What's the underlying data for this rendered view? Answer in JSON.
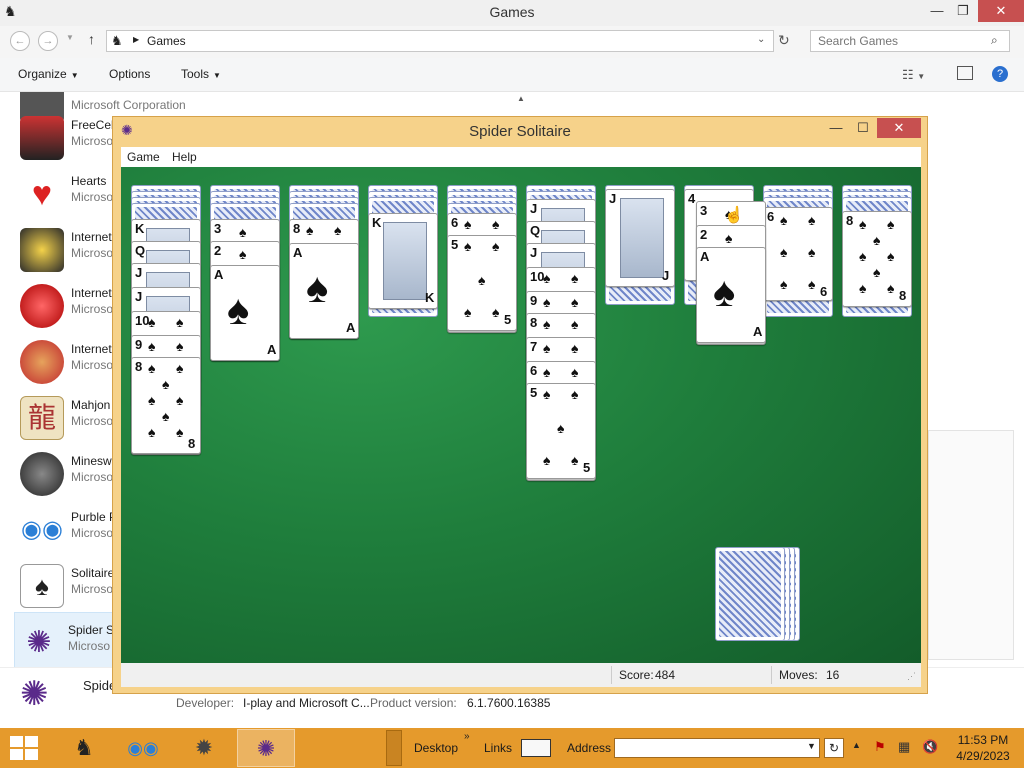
{
  "explorer": {
    "title": "Games",
    "breadcrumb": "Games",
    "search_placeholder": "Search Games",
    "commands": [
      "Organize",
      "Options",
      "Tools"
    ],
    "games": [
      {
        "name": "",
        "publisher": "Microsoft Corporation",
        "icon": "chess-icon"
      },
      {
        "name": "FreeCell",
        "publisher": "Microso",
        "icon": "freecell-icon"
      },
      {
        "name": "Hearts",
        "publisher": "Microso",
        "icon": "hearts-icon"
      },
      {
        "name": "Internet",
        "publisher": "Microso",
        "icon": "internet-backgammon-icon"
      },
      {
        "name": "Internet",
        "publisher": "Microso",
        "icon": "internet-checkers-icon"
      },
      {
        "name": "Internet",
        "publisher": "Microso",
        "icon": "internet-spades-icon"
      },
      {
        "name": "Mahjon",
        "publisher": "Microso",
        "icon": "mahjong-icon"
      },
      {
        "name": "Minesw",
        "publisher": "Microso",
        "icon": "minesweeper-icon"
      },
      {
        "name": "Purble P",
        "publisher": "Microso",
        "icon": "purble-place-icon"
      },
      {
        "name": "Solitaire",
        "publisher": "Microso",
        "icon": "solitaire-icon"
      },
      {
        "name": "Spider S",
        "publisher": "Microso",
        "icon": "spider-solitaire-icon"
      }
    ],
    "details": {
      "name": "Spide",
      "developer_label": "Developer:",
      "developer_value": "I-play and Microsoft C...",
      "product_version_label": "Product version:",
      "product_version_value": "6.1.7600.16385"
    }
  },
  "spider": {
    "title": "Spider Solitaire",
    "menu": [
      "Game",
      "Help"
    ],
    "status": {
      "score_label": "Score:",
      "score_value": "484",
      "moves_label": "Moves:",
      "moves_value": "16"
    }
  },
  "taskbar": {
    "desktop_label": "Desktop",
    "links_label": "Links",
    "address_label": "Address",
    "time": "11:53 PM",
    "date": "4/29/2023"
  }
}
